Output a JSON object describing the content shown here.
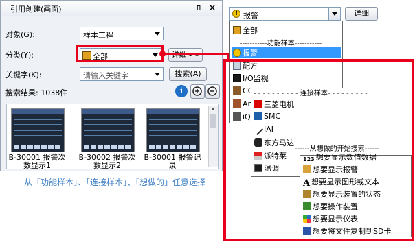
{
  "panel": {
    "title": "引用创建(画面)",
    "pin_glyph": "ᴨ",
    "close_glyph": "×",
    "object_label": "对象(G):",
    "object_value": "样本工程",
    "category_label": "分类(Y):",
    "category_value": "全部",
    "detail_label": "详细>>",
    "keyword_label": "关键字(K):",
    "keyword_placeholder": "请输入关键字",
    "search_label": "搜索(A)",
    "results_label": "搜索结果: 1038件",
    "thumbnails": [
      {
        "caption": "B-30001 报警次数显示1"
      },
      {
        "caption": "B-30002 报警次数显示2"
      },
      {
        "caption": "B-30001 报警记录"
      }
    ]
  },
  "note": "从「功能样本」、「连接样本」、「想做的」任意选择",
  "dropdown": {
    "selected": "报警",
    "detail_label": "详细",
    "items": {
      "all": "全部",
      "sep_function": "功能样本",
      "alarm": "报警",
      "recipe": "配方",
      "io": "I/O监视",
      "cc": "CC-",
      "any": "Any",
      "iqs": "iQS",
      "sep_connect": "连接样本",
      "mitsubishi": "三菱电机",
      "smc": "SMC",
      "iai": "IAI",
      "oriental": "东方马达",
      "patlite": "派特莱",
      "thermo": "温调",
      "sep_want": "从想做的开始搜索",
      "want_number": "想要显示数值数据",
      "want_alarm": "想要显示报警",
      "want_graphic": "想要显示图形或文本",
      "want_status": "想要显示装置的状态",
      "want_operate": "想要操作装置",
      "want_meter": "想要显示仪表",
      "want_copy": "想要将文件复制到SD卡"
    }
  },
  "colors": {
    "highlight": "#e8001c",
    "selection": "#3399ff",
    "note": "#3b7dc4"
  }
}
